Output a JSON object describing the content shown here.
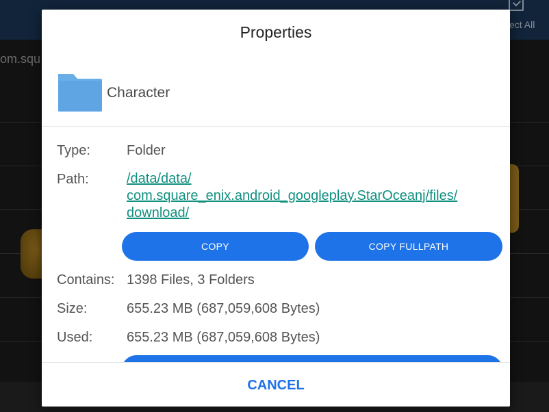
{
  "background": {
    "select_all_label": "ect All",
    "path_text": "om.squ"
  },
  "dialog": {
    "title": "Properties",
    "file_name": "Character",
    "properties": {
      "type_label": "Type:",
      "type_value": "Folder",
      "path_label": "Path:",
      "path_lines": [
        "/data/data/",
        "com.square_enix.android_googleplay.StarOceanj/files/",
        "download/"
      ],
      "copy_label": "COPY",
      "copy_fullpath_label": "COPY FULLPATH",
      "contains_label": "Contains:",
      "contains_value": "1398 Files, 3 Folders",
      "size_label": "Size:",
      "size_value": "655.23 MB (687,059,608 Bytes)",
      "used_label": "Used:",
      "used_value": "655.23 MB (687,059,608 Bytes)"
    },
    "cancel_label": "CANCEL"
  },
  "icons": {
    "folder": "folder-icon",
    "select_all": "checkbox-icon"
  },
  "colors": {
    "accent": "#1e73e8",
    "link": "#109080",
    "folder": "#6aaee8"
  }
}
